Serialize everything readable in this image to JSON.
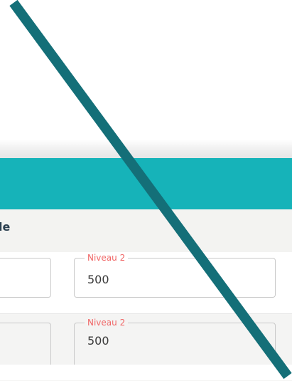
{
  "subheader": {
    "label": "le"
  },
  "rows": [
    {
      "field_legend": "Niveau 2",
      "field_value": "500"
    },
    {
      "field_legend": "Niveau 2",
      "field_value": "500"
    }
  ],
  "colors": {
    "header": "#16b3b9",
    "accent_legend": "#f06666",
    "overlay_line": "#146f78"
  }
}
